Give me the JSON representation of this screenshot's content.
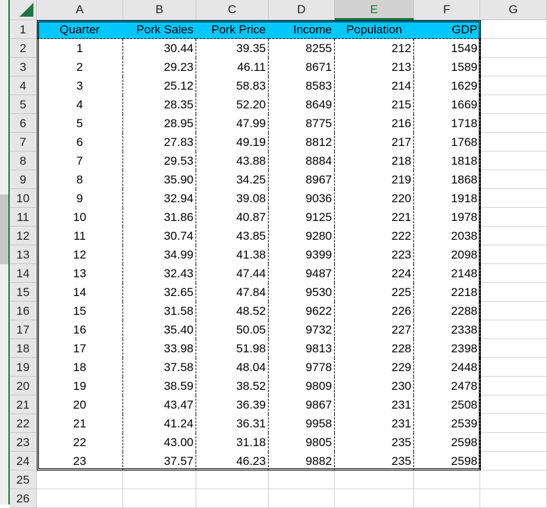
{
  "spreadsheet": {
    "column_headers": [
      "A",
      "B",
      "C",
      "D",
      "E",
      "F",
      "G"
    ],
    "selected_column": "E",
    "row_numbers": [
      "1",
      "2",
      "3",
      "4",
      "5",
      "6",
      "7",
      "8",
      "9",
      "10",
      "11",
      "12",
      "13",
      "14",
      "15",
      "16",
      "17",
      "18",
      "19",
      "20",
      "21",
      "22",
      "23",
      "24",
      "25",
      "26"
    ],
    "header_fill_color": "#00c8ff",
    "accent_color": "#217346",
    "table": {
      "headers": [
        "Quarter",
        "Pork Sales",
        "Pork Price",
        "Income",
        "Population",
        "GDP"
      ],
      "rows": [
        [
          "1",
          "30.44",
          "39.35",
          "8255",
          "212",
          "1549"
        ],
        [
          "2",
          "29.23",
          "46.11",
          "8671",
          "213",
          "1589"
        ],
        [
          "3",
          "25.12",
          "58.83",
          "8583",
          "214",
          "1629"
        ],
        [
          "4",
          "28.35",
          "52.20",
          "8649",
          "215",
          "1669"
        ],
        [
          "5",
          "28.95",
          "47.99",
          "8775",
          "216",
          "1718"
        ],
        [
          "6",
          "27.83",
          "49.19",
          "8812",
          "217",
          "1768"
        ],
        [
          "7",
          "29.53",
          "43.88",
          "8884",
          "218",
          "1818"
        ],
        [
          "8",
          "35.90",
          "34.25",
          "8967",
          "219",
          "1868"
        ],
        [
          "9",
          "32.94",
          "39.08",
          "9036",
          "220",
          "1918"
        ],
        [
          "10",
          "31.86",
          "40.87",
          "9125",
          "221",
          "1978"
        ],
        [
          "11",
          "30.74",
          "43.85",
          "9280",
          "222",
          "2038"
        ],
        [
          "12",
          "34.99",
          "41.38",
          "9399",
          "223",
          "2098"
        ],
        [
          "13",
          "32.43",
          "47.44",
          "9487",
          "224",
          "2148"
        ],
        [
          "14",
          "32.65",
          "47.84",
          "9530",
          "225",
          "2218"
        ],
        [
          "15",
          "31.58",
          "48.52",
          "9622",
          "226",
          "2288"
        ],
        [
          "16",
          "35.40",
          "50.05",
          "9732",
          "227",
          "2338"
        ],
        [
          "17",
          "33.98",
          "51.98",
          "9813",
          "228",
          "2398"
        ],
        [
          "18",
          "37.58",
          "48.04",
          "9778",
          "229",
          "2448"
        ],
        [
          "19",
          "38.59",
          "38.52",
          "9809",
          "230",
          "2478"
        ],
        [
          "20",
          "43.47",
          "36.39",
          "9867",
          "231",
          "2508"
        ],
        [
          "21",
          "41.24",
          "36.31",
          "9958",
          "231",
          "2539"
        ],
        [
          "22",
          "43.00",
          "31.18",
          "9805",
          "235",
          "2598"
        ],
        [
          "23",
          "37.57",
          "46.23",
          "9882",
          "235",
          "2598"
        ]
      ]
    }
  }
}
